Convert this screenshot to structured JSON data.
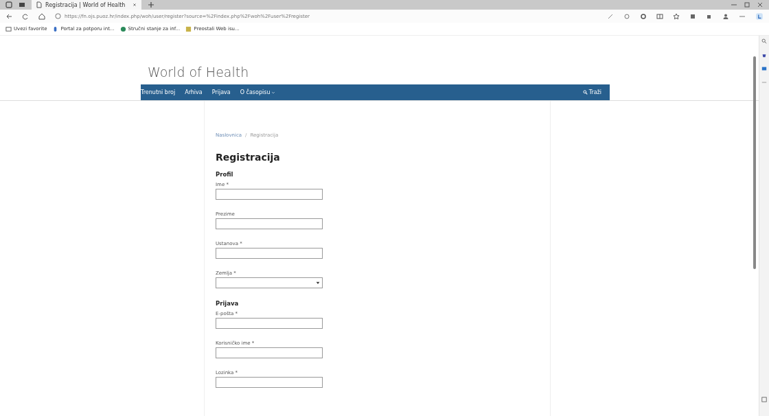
{
  "browser": {
    "tab_title": "Registracija | World of Health",
    "url": "https://fn.ojs.puoz.hr/index.php/woh/user/register?source=%2Findex.php%2Fwoh%2Fuser%2Fregister",
    "bookmarks": [
      {
        "label": "Uvezi favorite"
      },
      {
        "label": "Portal za potporu int..."
      },
      {
        "label": "Stručni stanje za inf..."
      },
      {
        "label": "Preostali Web isu..."
      }
    ]
  },
  "site": {
    "title": "World of Health",
    "nav": [
      {
        "label": "Trenutni broj",
        "dropdown": false
      },
      {
        "label": "Arhiva",
        "dropdown": false
      },
      {
        "label": "Prijava",
        "dropdown": false
      },
      {
        "label": "O časopisu",
        "dropdown": true
      }
    ],
    "search": "Traži"
  },
  "breadcrumb": [
    "Naslovnica",
    "Registracija"
  ],
  "breadcrumb_separator": "/",
  "heading": "Registracija",
  "sections": [
    {
      "title": "Profil",
      "fields": [
        {
          "label": "Ime *",
          "kind": "text"
        },
        {
          "label": "Prezime",
          "kind": "text"
        },
        {
          "label": "Ustanova *",
          "kind": "text"
        },
        {
          "label": "Zemlja *",
          "kind": "select"
        }
      ]
    },
    {
      "title": "Prijava",
      "fields": [
        {
          "label": "E-pošta *",
          "kind": "text"
        },
        {
          "label": "Korisničko ime *",
          "kind": "text"
        },
        {
          "label": "Lozinka *",
          "kind": "text"
        }
      ]
    }
  ]
}
